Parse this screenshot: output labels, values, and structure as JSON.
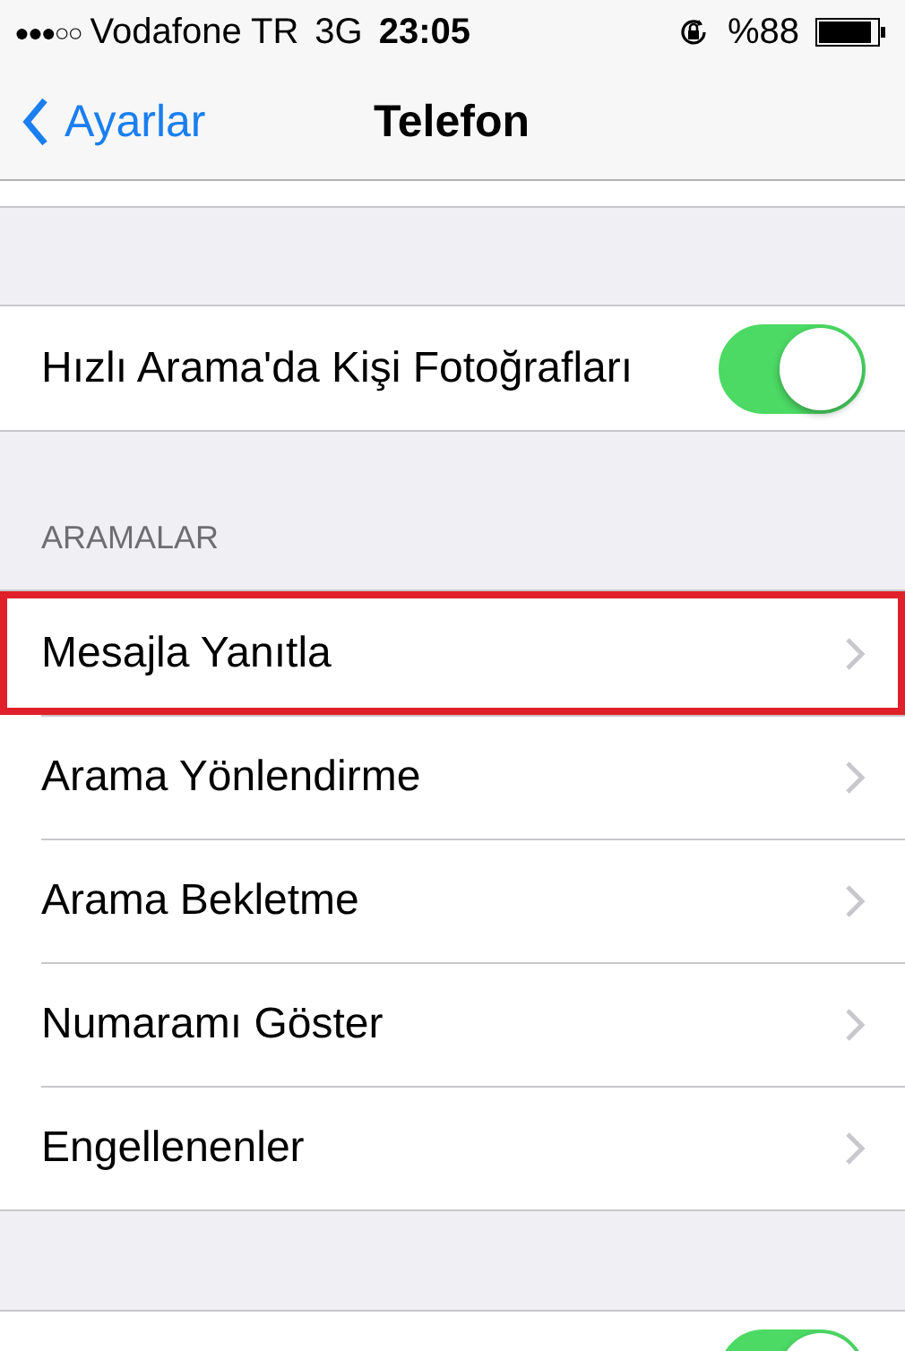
{
  "status_bar": {
    "signal_dots": "●●●○○",
    "carrier": "Vodafone TR",
    "network": "3G",
    "time": "23:05",
    "battery": "%88"
  },
  "nav_bar": {
    "back": "Ayarlar",
    "title": "Telefon"
  },
  "photo_row": {
    "label": "Hızlı Arama'da Kişi Fotoğrafları",
    "on": true
  },
  "calls_section": {
    "header": "ARAMALAR",
    "items": [
      {
        "label": "Mesajla Yanıtla",
        "highlighted": true
      },
      {
        "label": "Arama Yönlendirme",
        "highlighted": false
      },
      {
        "label": "Arama Bekletme",
        "highlighted": false
      },
      {
        "label": "Numaramı Göster",
        "highlighted": false
      },
      {
        "label": "Engellenenler",
        "highlighted": false
      }
    ]
  },
  "bottom_row": {
    "on": true
  }
}
